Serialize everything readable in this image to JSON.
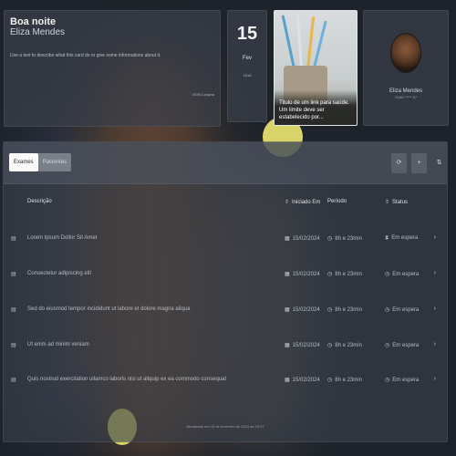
{
  "greeting": {
    "title": "Boa noite",
    "name": "Eliza Mendes",
    "description": "Use a text to describe what this card do or give some informations about it.",
    "time": "VIDEO-aqsha"
  },
  "date": {
    "day": "15",
    "month": "Fev",
    "year": "1818"
  },
  "news": {
    "caption": "Titulo de um link para saúde. Um limite deve ser estabelecido por..."
  },
  "profile": {
    "name": "Eliza Mendes",
    "id": "1SA5 ***** 67"
  },
  "tabs": [
    {
      "label": "Exames",
      "active": true
    },
    {
      "label": "Pacientes",
      "active": false
    }
  ],
  "toolbar": {
    "refresh_icon": "⟳",
    "add_icon": "+",
    "filter_icon": "⇅"
  },
  "table": {
    "headers": {
      "description": "Descrição",
      "started": "Iniciado Em",
      "period": "Período",
      "status": "Status"
    },
    "rows": [
      {
        "description": "Lorem Ipsum Dollor Sit Amet",
        "started": "15/02/2024",
        "period": "8h e 23min",
        "status": "Em espera"
      },
      {
        "description": "Consectetur adipiscing elit",
        "started": "15/02/2024",
        "period": "8h e 23min",
        "status": "Em espera"
      },
      {
        "description": "Sed do eiusmod tempor incididunt ut labore et dolore magna aliqua",
        "started": "15/02/2024",
        "period": "8h e 23min",
        "status": "Em espera"
      },
      {
        "description": "Ut enim ad minim veniam",
        "started": "15/02/2024",
        "period": "8h e 23min",
        "status": "Em espera"
      },
      {
        "description": "Quis nostrud exercitation ullamco laboris nisi ut aliquip ex ea commodo consequat",
        "started": "15/02/2024",
        "period": "8h e 23min",
        "status": "Em espera"
      }
    ]
  },
  "footer": {
    "updated": "Atualizado em 15 de fevereiro de 2024 às 23:07"
  },
  "colors": {
    "background": "#1e232b",
    "card": "#3a404a",
    "accent_ball": "#d8d46a"
  },
  "icons": {
    "document": "document-icon",
    "calendar": "calendar-icon",
    "clock": "clock-icon",
    "hourglass": "hourglass-icon",
    "chevron": "chevron-right-icon",
    "sort": "sort-icon"
  }
}
